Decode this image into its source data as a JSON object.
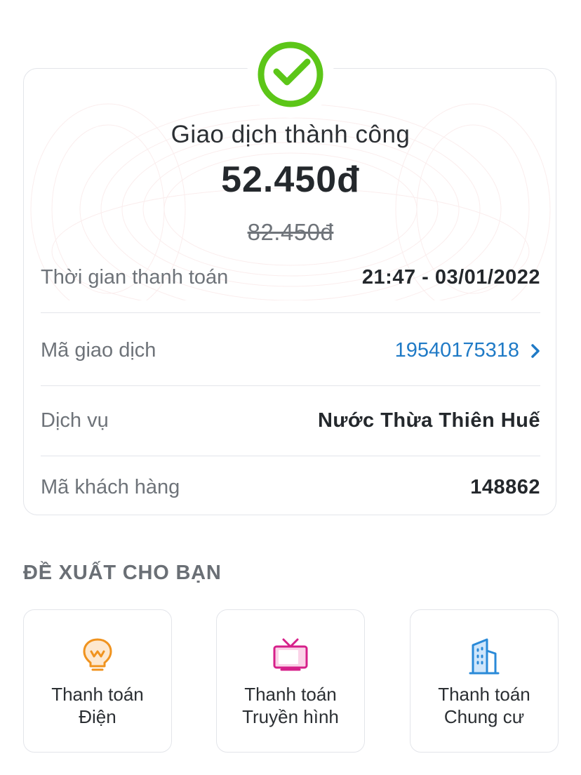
{
  "receipt": {
    "status": "Giao dịch thành công",
    "amount": "52.450đ",
    "original_amount": "82.450đ",
    "rows": [
      {
        "label": "Thời gian thanh toán",
        "value": "21:47 - 03/01/2022"
      },
      {
        "label": "Mã giao dịch",
        "value": "19540175318"
      },
      {
        "label": "Dịch vụ",
        "value": "Nước Thừa Thiên Huế"
      },
      {
        "label": "Mã khách hàng",
        "value": "148862"
      }
    ]
  },
  "suggestions": {
    "title": "ĐỀ XUẤT CHO BẠN",
    "items": [
      {
        "line1": "Thanh toán",
        "line2": "Điện",
        "icon": "lightbulb-icon"
      },
      {
        "line1": "Thanh toán",
        "line2": "Truyền hình",
        "icon": "tv-icon"
      },
      {
        "line1": "Thanh toán",
        "line2": "Chung cư",
        "icon": "building-icon"
      }
    ]
  },
  "colors": {
    "success": "#5cc618",
    "link": "#1f7ac6",
    "electric": "#f0931e",
    "tv": "#d6208a",
    "building": "#2a8ad8"
  }
}
